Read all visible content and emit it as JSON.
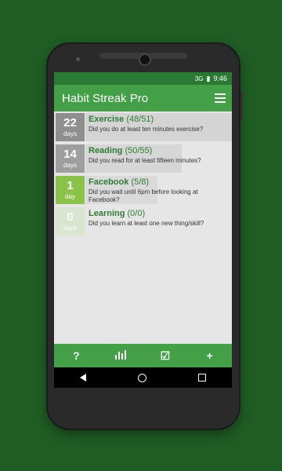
{
  "status": {
    "network": "3G",
    "time": "9:46"
  },
  "app": {
    "title": "Habit Streak Pro"
  },
  "habits": [
    {
      "count": "22",
      "unit": "days",
      "name": "Exercise",
      "score": "(48/51)",
      "question": "Did you do at least ten minutes exercise?",
      "box_color": "#8f8f8f",
      "bar_color": "#d4d4d4",
      "bar_fraction": 1.0
    },
    {
      "count": "14",
      "unit": "days",
      "name": "Reading",
      "score": "(50/55)",
      "question": "Did you read for at least fifteen minutes?",
      "box_color": "#9e9e9e",
      "bar_color": "#d6d6d6",
      "bar_fraction": 0.66
    },
    {
      "count": "1",
      "unit": "day",
      "name": "Facebook",
      "score": "(5/8)",
      "question": "Did you wait until 6pm before looking at Facebook?",
      "box_color": "#8bc34a",
      "bar_color": "#dadada",
      "bar_fraction": 0.49
    },
    {
      "count": "0",
      "unit": "days",
      "name": "Learning",
      "score": "(0/0)",
      "question": "Did you learn at least one new thing/skill?",
      "box_color": "#d8e6cf",
      "bar_color": "#e6e6e6",
      "bar_fraction": 0.0
    }
  ],
  "bottom_actions": [
    {
      "label": "?",
      "icon": "help-icon"
    },
    {
      "label": "▮▮▮",
      "icon": "stats-icon"
    },
    {
      "label": "☑",
      "icon": "checkbox-icon"
    },
    {
      "label": "+",
      "icon": "add-icon"
    }
  ],
  "colors": {
    "accent": "#43a047",
    "status_bar": "#2b7a34",
    "background": "#1f5d24"
  }
}
